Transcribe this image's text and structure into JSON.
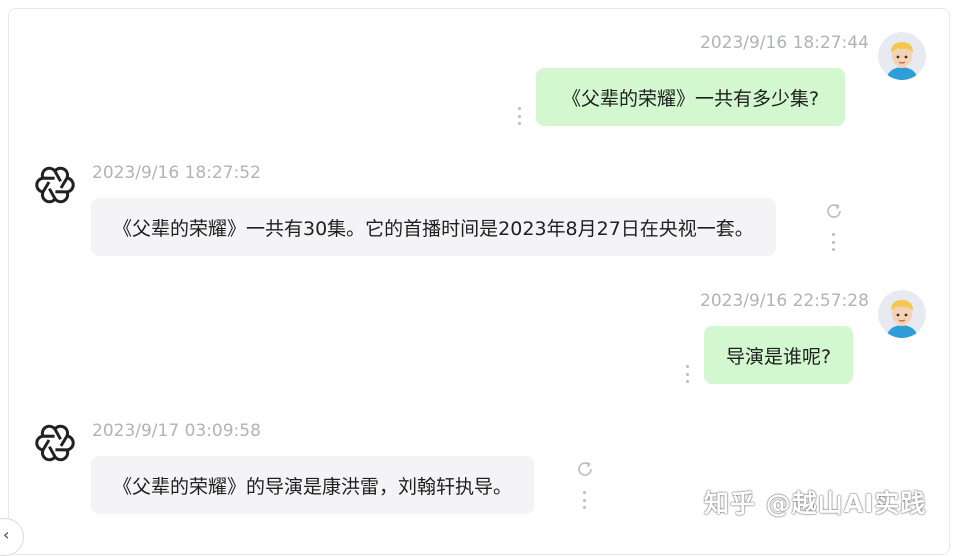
{
  "messages": [
    {
      "role": "user",
      "timestamp": "2023/9/16 18:27:44",
      "text": "《父辈的荣耀》一共有多少集?"
    },
    {
      "role": "assistant",
      "timestamp": "2023/9/16 18:27:52",
      "text": "《父辈的荣耀》一共有30集。它的首播时间是2023年8月27日在央视一套。"
    },
    {
      "role": "user",
      "timestamp": "2023/9/16 22:57:28",
      "text": "导演是谁呢?"
    },
    {
      "role": "assistant",
      "timestamp": "2023/9/17 03:09:58",
      "text": "《父辈的荣耀》的导演是康洪雷，刘翰轩执导。"
    }
  ],
  "watermark": "知乎 @越山AI实践",
  "icons": {
    "user_avatar": "user-avatar-icon",
    "assistant_avatar": "openai-logo-icon",
    "more": "vertical-dots-icon",
    "regenerate": "refresh-icon",
    "collapse": "chevron-left-icon"
  },
  "colors": {
    "user_bubble": "#d3f7cf",
    "assistant_bubble": "#f4f4f6",
    "timestamp": "#b0b3b8"
  }
}
